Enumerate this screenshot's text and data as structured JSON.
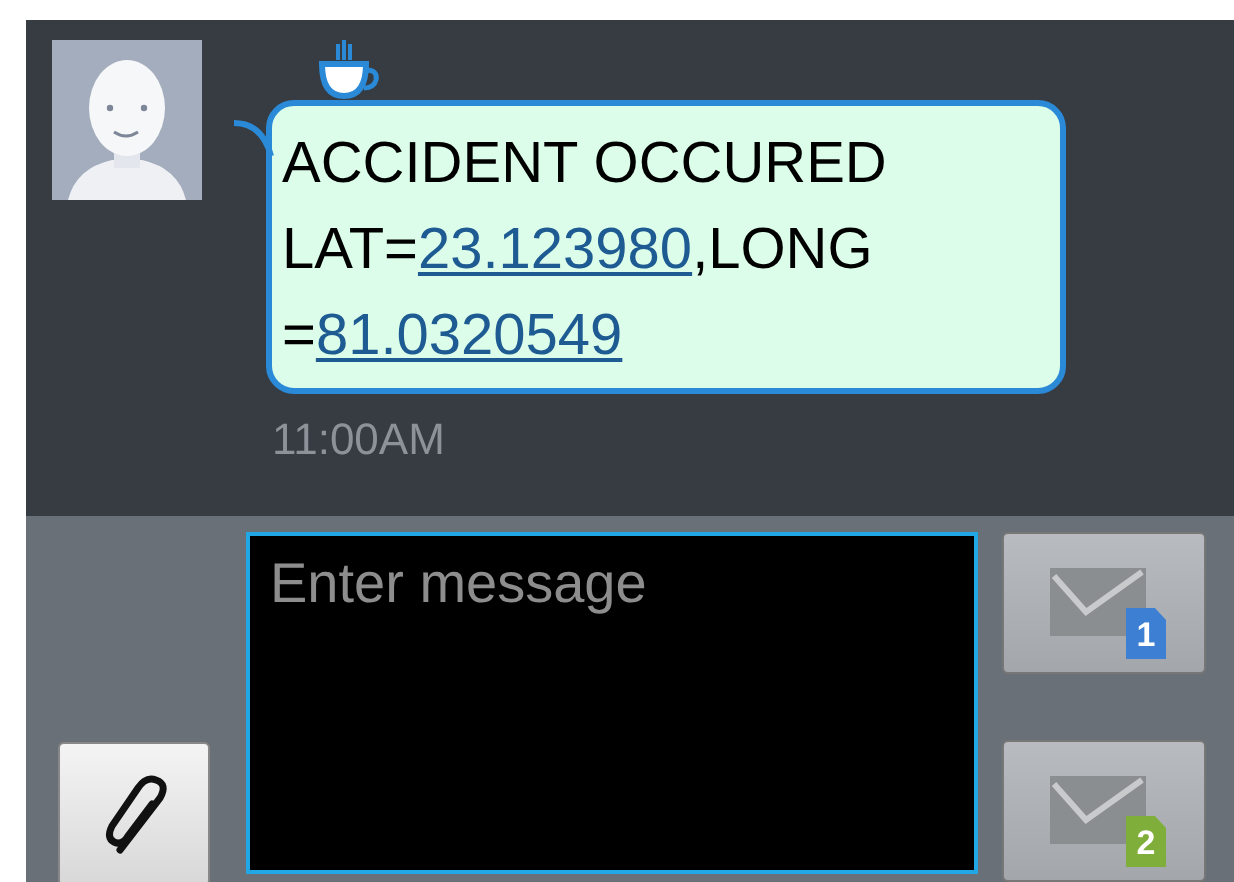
{
  "message": {
    "lines": [
      [
        {
          "kind": "text",
          "text": "ACCIDENT OCCURED"
        }
      ],
      [
        {
          "kind": "text",
          "text": "LAT="
        },
        {
          "kind": "link",
          "text": "23.123980"
        },
        {
          "kind": "text",
          "text": ",LONG"
        }
      ],
      [
        {
          "kind": "text",
          "text": "="
        },
        {
          "kind": "link",
          "text": "81.0320549"
        }
      ]
    ],
    "time": "11:00AM"
  },
  "composer": {
    "placeholder": "Enter message"
  },
  "send_buttons": [
    {
      "sim": "1",
      "color": "#3d7fd3"
    },
    {
      "sim": "2",
      "color": "#7fae3a"
    }
  ]
}
